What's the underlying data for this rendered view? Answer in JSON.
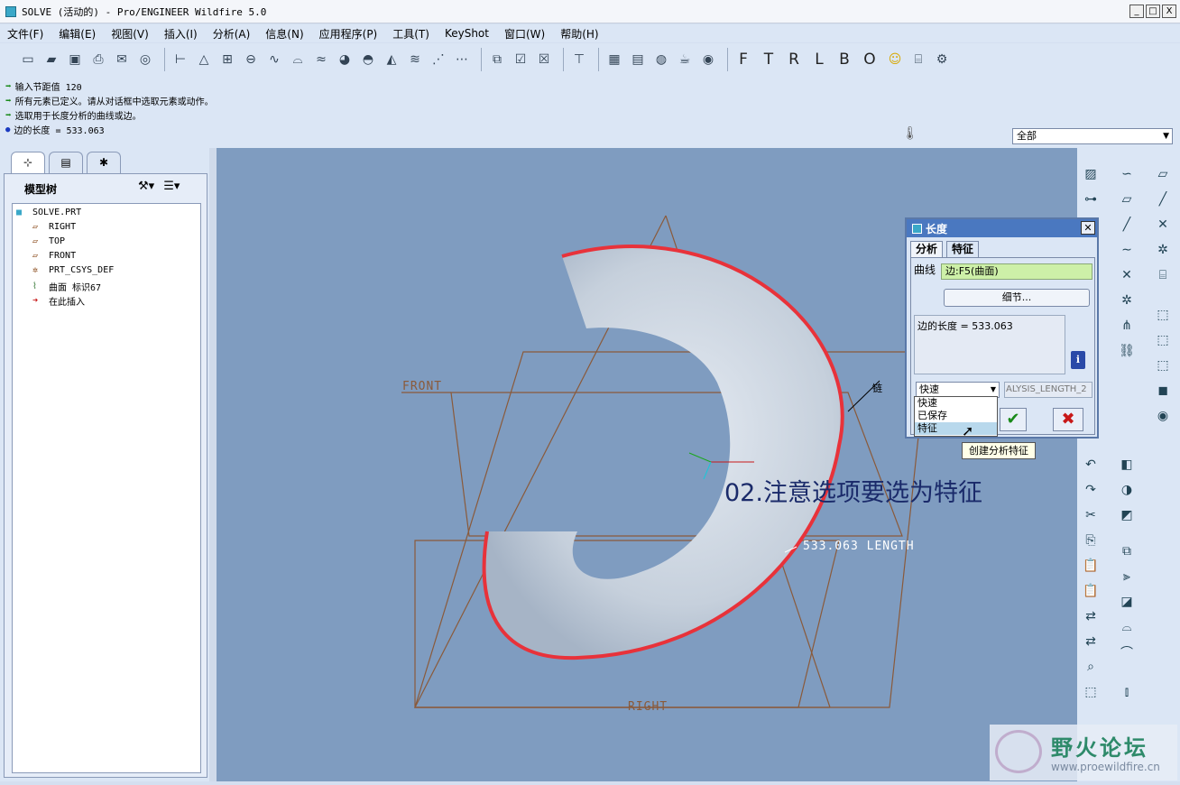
{
  "window": {
    "title": "SOLVE (活动的) - Pro/ENGINEER Wildfire 5.0",
    "min": "_",
    "max": "□",
    "close": "X"
  },
  "menu": [
    "文件(F)",
    "编辑(E)",
    "视图(V)",
    "插入(I)",
    "分析(A)",
    "信息(N)",
    "应用程序(P)",
    "工具(T)",
    "KeyShot",
    "窗口(W)",
    "帮助(H)"
  ],
  "toolbar_letters": [
    "F",
    "T",
    "R",
    "L",
    "B",
    "O"
  ],
  "messages": [
    {
      "text": "输入节距值    120",
      "icon": "green-arrow"
    },
    {
      "text": "所有元素已定义。请从对话框中选取元素或动作。",
      "icon": "green-arrow"
    },
    {
      "text": "选取用于长度分析的曲线或边。",
      "icon": "green-arrow"
    },
    {
      "text": "边的长度 = 533.063",
      "icon": "blue-dot"
    }
  ],
  "filter": {
    "value": "全部"
  },
  "tree": {
    "title": "模型树",
    "items": [
      "SOLVE.PRT",
      "RIGHT",
      "TOP",
      "FRONT",
      "PRT_CSYS_DEF",
      "曲面 标识67",
      "在此插入"
    ]
  },
  "viewport": {
    "labels": {
      "front": "FRONT",
      "right": "RIGHT",
      "dim": "533.063 LENGTH",
      "edge": "链"
    },
    "annotation": "02.注意选项要选为特征"
  },
  "dialog": {
    "title": "长度",
    "tabs": [
      "分析",
      "特征"
    ],
    "curve_label": "曲线",
    "curve_value": "边:F5(曲面)",
    "detail_button": "细节...",
    "result": "边的长度 = 533.063",
    "type_value": "快速",
    "name_value": "ALYSIS_LENGTH_2",
    "options": [
      "快速",
      "已保存",
      "特征"
    ],
    "tooltip": "创建分析特征"
  },
  "watermark": {
    "text": "野火论坛",
    "url": "www.proewildfire.cn"
  },
  "colors": {
    "viewport_bg": "#7f9cc0",
    "edge_highlight": "#e8323a",
    "datum": "#8a5a3a",
    "annotation": "#1a2a6a"
  }
}
